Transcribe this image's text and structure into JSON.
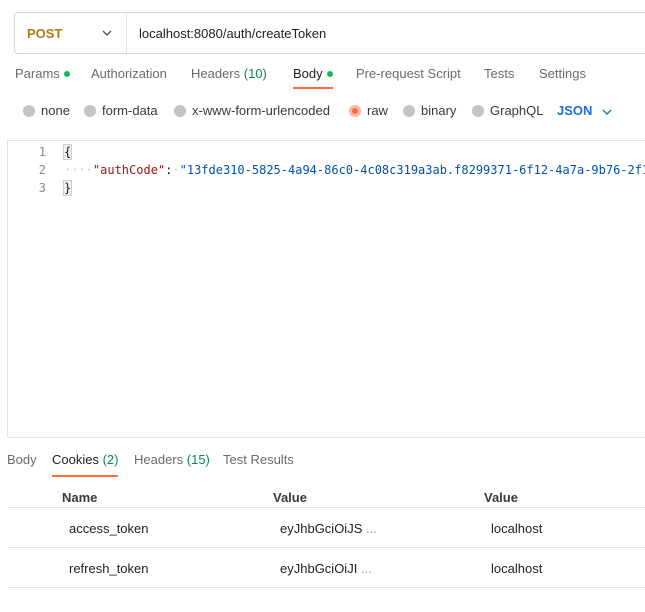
{
  "request": {
    "method": "POST",
    "url": "localhost:8080/auth/createToken"
  },
  "request_tabs": [
    {
      "label": "Params",
      "dot": true
    },
    {
      "label": "Authorization"
    },
    {
      "label": "Headers",
      "count": "(10)"
    },
    {
      "label": "Body",
      "dot": true,
      "active": true
    },
    {
      "label": "Pre-request Script"
    },
    {
      "label": "Tests"
    },
    {
      "label": "Settings"
    }
  ],
  "body_types": {
    "options": [
      "none",
      "form-data",
      "x-www-form-urlencoded",
      "raw",
      "binary",
      "GraphQL"
    ],
    "selected": "raw",
    "format": "JSON"
  },
  "editor": {
    "line_numbers": [
      "1",
      "2",
      "3"
    ],
    "open_brace": "{",
    "close_brace": "}",
    "indent": "····",
    "key": "\"authCode\"",
    "colon": ":",
    "value": "\"13fde310-5825-4a94-86c0-4c08c319a3ab.f8299371-6f12-4a7a-9b76-2f1"
  },
  "response_tabs": [
    {
      "label": "Body"
    },
    {
      "label": "Cookies",
      "count": "(2)",
      "active": true
    },
    {
      "label": "Headers",
      "count": "(15)"
    },
    {
      "label": "Test Results"
    }
  ],
  "cookies_table": {
    "columns": [
      "Name",
      "Value",
      "Value"
    ],
    "rows": [
      {
        "name": "access_token",
        "value": "eyJhbGciOiJS",
        "ellipsis": "...",
        "domain": "localhost"
      },
      {
        "name": "refresh_token",
        "value": "eyJhbGciOiJI",
        "ellipsis": "...",
        "domain": "localhost"
      }
    ]
  },
  "colors": {
    "accent": "#ff6c37",
    "method": "#b07a10",
    "json_format": "#1e6dd6",
    "status_dot": "#0cbb52"
  }
}
